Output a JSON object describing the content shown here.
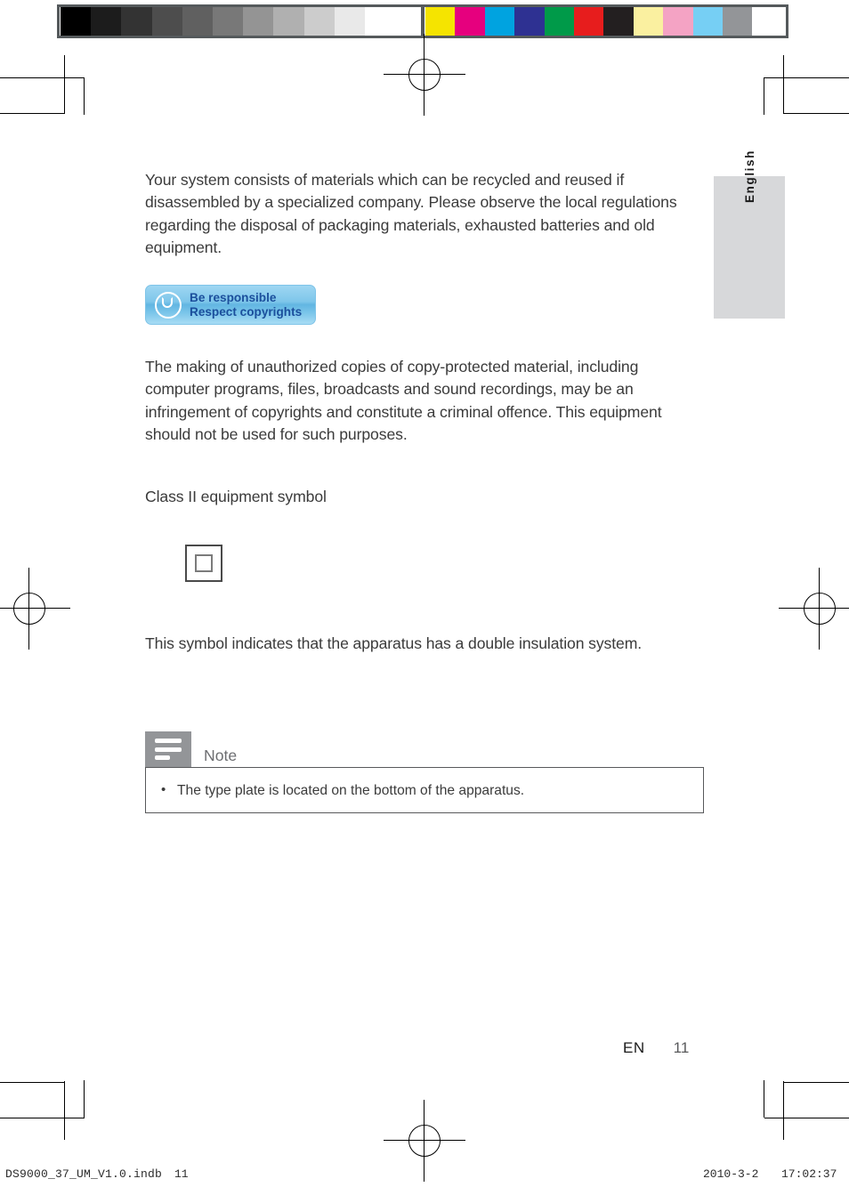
{
  "document": {
    "language_tab": "English",
    "page_label": "EN",
    "page_number": "11"
  },
  "calibration_strip": {
    "grayscale": [
      "#000000",
      "#1c1c1c",
      "#333333",
      "#4d4d4d",
      "#606060",
      "#787878",
      "#949494",
      "#b0b0b0",
      "#cccccc",
      "#e9e9e9",
      "#ffffff"
    ],
    "colors": [
      "#f5e400",
      "#e6007e",
      "#00a3e0",
      "#2e3192",
      "#009a49",
      "#e71d1d",
      "#231f20",
      "#faf0a0",
      "#f4a3c4",
      "#76cff4",
      "#939598"
    ],
    "border_color": "#555a5c"
  },
  "content": {
    "paragraph_recycling": "Your system consists of materials which can be recycled and reused if disassembled by a specialized company. Please observe the local regulations regarding the disposal of packaging materials, exhausted batteries and old equipment.",
    "paragraph_copyright": "The making of unauthorized copies of copy-protected material, including computer programs, files, broadcasts and sound recordings, may be an infringement of copyrights and constitute a criminal offence. This equipment should not be used for such purposes.",
    "heading_class_ii": "Class II equipment symbol",
    "paragraph_double_insulation": "This symbol indicates that the apparatus has a double insulation system."
  },
  "copyright_badge": {
    "line1": "Be responsible",
    "line2": "Respect copyrights",
    "text_color": "#1b4f9c",
    "background_color": "#7ec6ea",
    "border_color": "#7fc4e8"
  },
  "class_ii_symbol": {
    "outer_border_color": "#4a4a4a",
    "inner_border_color": "#7b7b7b"
  },
  "note": {
    "title": "Note",
    "icon_background": "#939598",
    "border_color": "#58595b",
    "items": [
      "The type plate is located on the bottom of the apparatus."
    ]
  },
  "print_footer": {
    "file_name": "DS9000_37_UM_V1.0.indb",
    "sheet_number": "11",
    "date": "2010-3-2",
    "time": "17:02:37"
  }
}
